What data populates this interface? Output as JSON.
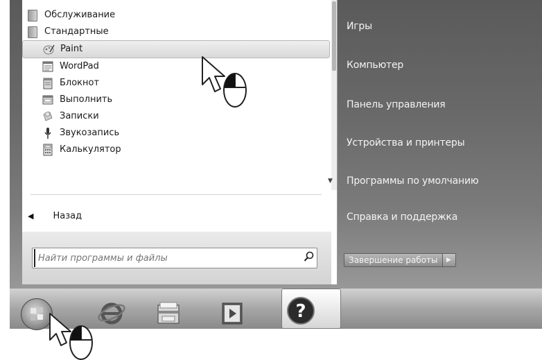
{
  "programs": {
    "items": [
      {
        "label": "Обслуживание",
        "icon": "folder-icon"
      },
      {
        "label": "Стандартные",
        "icon": "folder-icon"
      },
      {
        "label": "Paint",
        "icon": "paint-icon"
      },
      {
        "label": "WordPad",
        "icon": "wordpad-icon"
      },
      {
        "label": "Блокнот",
        "icon": "notepad-icon"
      },
      {
        "label": "Выполнить",
        "icon": "run-icon"
      },
      {
        "label": "Записки",
        "icon": "sticky-notes-icon"
      },
      {
        "label": "Звукозапись",
        "icon": "microphone-icon"
      },
      {
        "label": "Калькулятор",
        "icon": "calculator-icon"
      }
    ],
    "back_label": "Назад"
  },
  "search": {
    "placeholder": "Найти программы и файлы",
    "icon": "magnifier-icon"
  },
  "right_panel": {
    "items": [
      "Игры",
      "Компьютер",
      "Панель управления",
      "Устройства и принтеры",
      "Программы по умолчанию",
      "Справка и поддержка"
    ],
    "shutdown_label": "Завершение работы"
  },
  "taskbar": {
    "items": [
      "start-orb-icon",
      "internet-explorer-icon",
      "file-explorer-icon",
      "media-player-icon",
      "help-icon"
    ]
  },
  "colors": {
    "right_panel_top": "#5a5a5a",
    "right_panel_bottom": "#9c9c9c",
    "highlight": "#d9d9d9"
  }
}
